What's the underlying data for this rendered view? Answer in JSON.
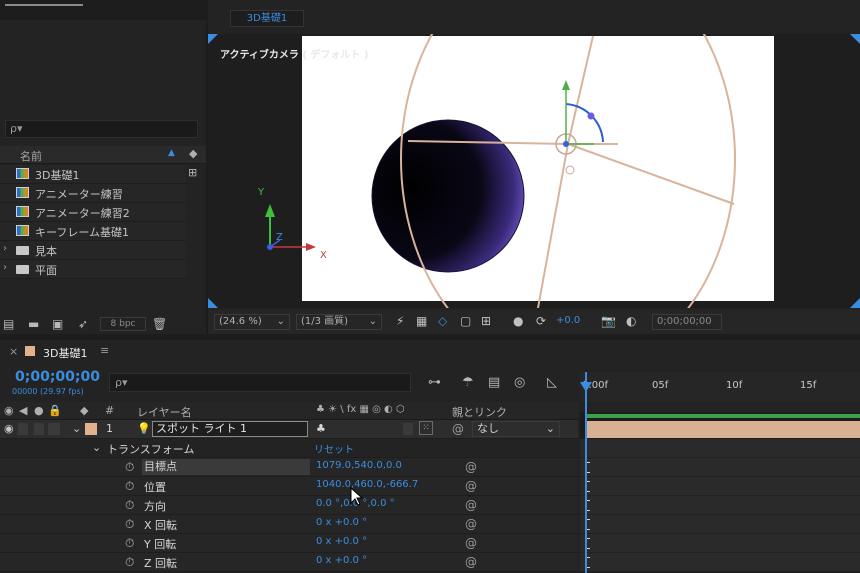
{
  "project": {
    "search_placeholder": "ρ▾",
    "column_name": "名前",
    "items": [
      {
        "name": "3D基礎1",
        "type": "comp"
      },
      {
        "name": "アニメーター練習",
        "type": "comp"
      },
      {
        "name": "アニメーター練習2",
        "type": "comp"
      },
      {
        "name": "キーフレーム基礎1",
        "type": "comp"
      },
      {
        "name": "見本",
        "type": "folder"
      },
      {
        "name": "平面",
        "type": "folder"
      }
    ],
    "bpc": "8 bpc"
  },
  "composition": {
    "tab": "3D基礎1",
    "camera_label": "アクティブカメラ ( デフォルト )",
    "axis_y": "Y",
    "axis_z": "Z",
    "axis_x": "X",
    "zoom": "(24.6 %)",
    "resolution": "(1/3 画質)",
    "exposure": "+0.0",
    "timecode": "0;00;00;00",
    "colors": {
      "sphere": "#7a5ce8",
      "light_wire": "#d6b49c",
      "canvas": "#ffffff"
    }
  },
  "timeline": {
    "tab_name": "3D基礎1",
    "timecode": "0;00;00;00",
    "fps": "00000 (29.97 fps)",
    "search_placeholder": "ρ▾",
    "columns": {
      "num": "#",
      "layer_name": "レイヤー名",
      "switches": "♣ ☀ \\ fx ▦ ◎ ◐ ⬡",
      "parent": "親とリンク"
    },
    "layer": {
      "num": "1",
      "name": "スポット ライト 1",
      "parent": "なし"
    },
    "transform": {
      "label": "トランスフォーム",
      "reset": "リセット"
    },
    "properties": [
      {
        "name": "目標点",
        "value": "1079.0,540.0,0.0"
      },
      {
        "name": "位置",
        "value": "1040.0,460.0,-666.7"
      },
      {
        "name": "方向",
        "value": "0.0 °,0.0 °,0.0 °"
      },
      {
        "name": "X 回転",
        "value": "0 x +0.0 °"
      },
      {
        "name": "Y 回転",
        "value": "0 x +0.0 °"
      },
      {
        "name": "Z 回転",
        "value": "0 x +0.0 °"
      }
    ],
    "ruler": [
      "0:00f",
      "05f",
      "10f",
      "15f"
    ]
  }
}
